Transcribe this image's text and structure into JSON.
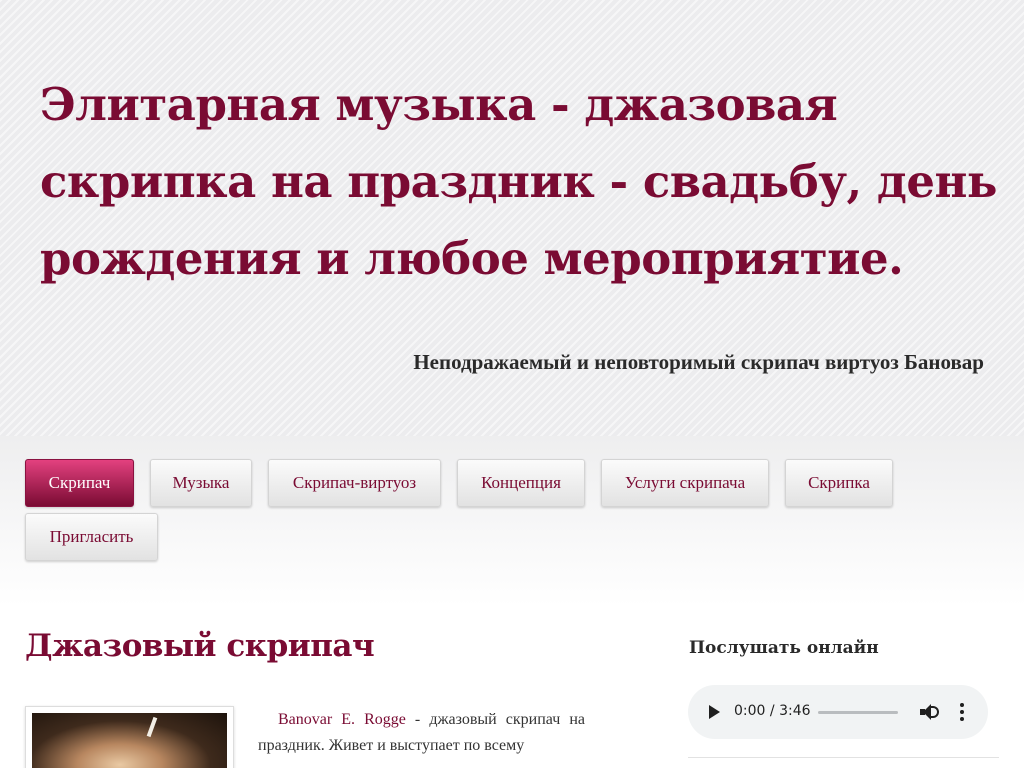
{
  "header": {
    "site_title": "Элитарная музыка - джазовая скрипка на праздник - свадьбу, день рождения и любое мероприятие.",
    "slogan": "Неподражаемый и неповторимый скрипач виртуоз Бановар"
  },
  "menu": {
    "active_index": 0,
    "items": [
      {
        "label": "Скрипач"
      },
      {
        "label": "Музыка"
      },
      {
        "label": "Скрипач-виртуоз"
      },
      {
        "label": "Концепция"
      },
      {
        "label": "Услуги скрипача"
      },
      {
        "label": "Скрипка"
      },
      {
        "label": "Пригласить"
      }
    ]
  },
  "content": {
    "page_title": "Джазовый скрипач",
    "article": {
      "link_text": "Banovar E. Rogge",
      "text": " - джазовый скрипач на праздник. Живет и выступает по всему"
    }
  },
  "sidebar": {
    "title": "Послушать онлайн",
    "audio": {
      "current_time": "0:00",
      "separator": " / ",
      "duration": "3:46",
      "progress_fraction": 0
    }
  },
  "colors": {
    "accent": "#7a0b33",
    "active_menu_top": "#e3417f",
    "active_menu_bottom": "#7a0b33"
  },
  "icons": {
    "play": "play-icon",
    "volume": "volume-icon",
    "more": "more-vertical-icon"
  }
}
